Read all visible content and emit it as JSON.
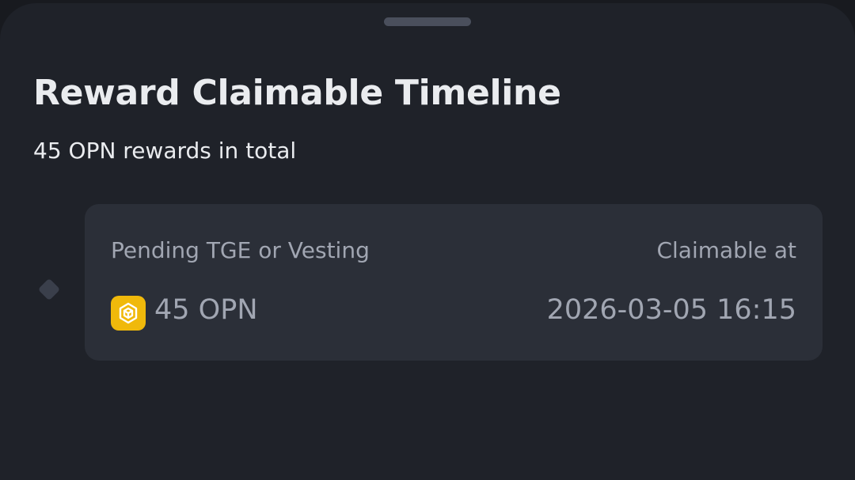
{
  "sheet": {
    "title": "Reward Claimable Timeline",
    "subtitle": "45 OPN rewards in total"
  },
  "timeline": {
    "items": [
      {
        "status": "Pending TGE or Vesting",
        "claim_label": "Claimable at",
        "amount": "45 OPN",
        "claim_time": "2026-03-05 16:15",
        "token_icon": "bnb-cube-icon"
      }
    ]
  },
  "colors": {
    "background": "#1f2229",
    "card": "#2b2f38",
    "accent": "#f0b90b",
    "primary_text": "#eaecef",
    "secondary_text": "#a1a6b2"
  }
}
